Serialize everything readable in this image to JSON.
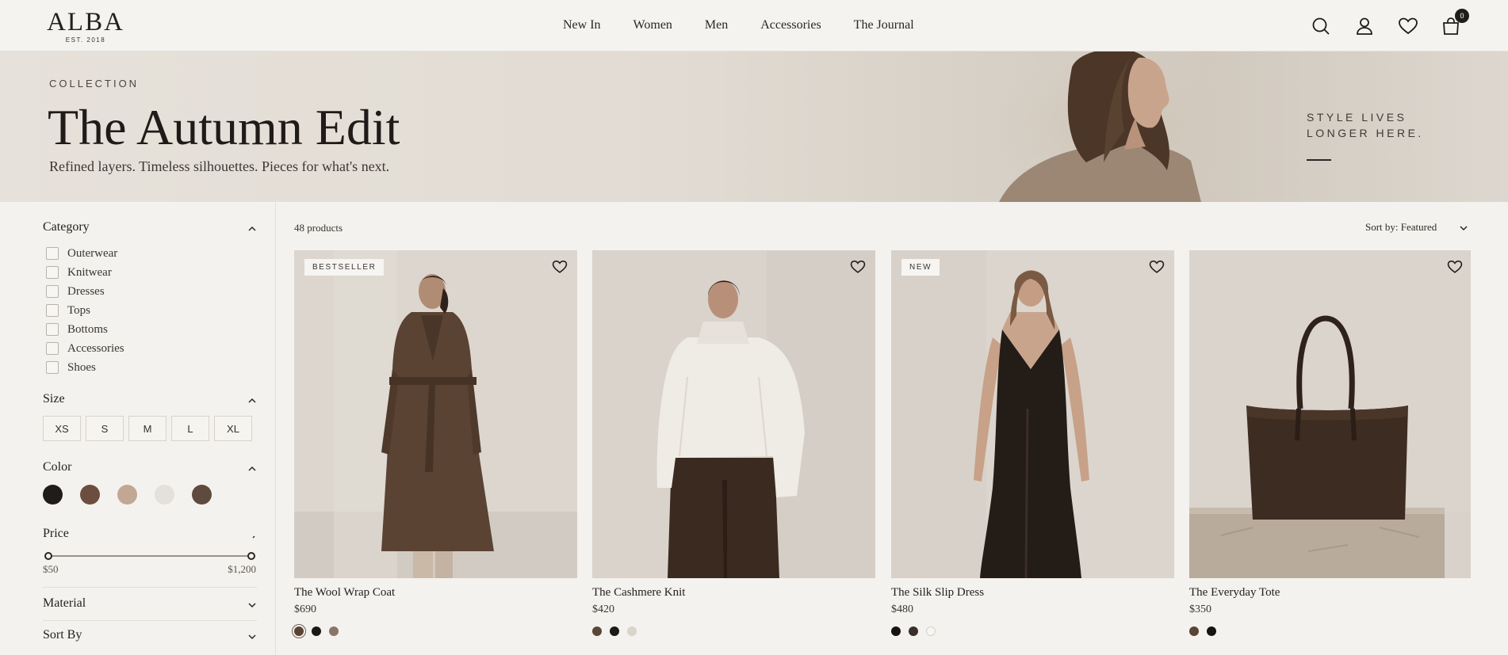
{
  "header": {
    "logo": {
      "name": "ALBA",
      "tagline": "EST. 2018"
    },
    "nav": [
      "New In",
      "Women",
      "Men",
      "Accessories",
      "The Journal"
    ],
    "icons": [
      "search-icon",
      "account-icon",
      "wishlist-icon",
      "bag-icon"
    ],
    "bag_count": "0"
  },
  "hero": {
    "eyebrow": "COLLECTION",
    "title": "The Autumn Edit",
    "subtitle": "Refined layers. Timeless silhouettes. Pieces for what's next.",
    "tagline_line1": "STYLE LIVES",
    "tagline_line2": "LONGER HERE."
  },
  "filters": {
    "category": {
      "label": "Category",
      "items": [
        "Outerwear",
        "Knitwear",
        "Dresses",
        "Tops",
        "Bottoms",
        "Accessories",
        "Shoes"
      ]
    },
    "size": {
      "label": "Size",
      "options": [
        "XS",
        "S",
        "M",
        "L",
        "XL"
      ]
    },
    "color": {
      "label": "Color",
      "swatches": [
        "#1f1c1a",
        "#6b4e3d",
        "#c2a792",
        "#e4e0db",
        "#5f4a3e"
      ]
    },
    "price": {
      "label": "Price",
      "min": "$50",
      "max": "$1,200"
    },
    "material": {
      "label": "Material"
    },
    "sort_by": {
      "label": "Sort By"
    }
  },
  "listing": {
    "count": "48 products",
    "sort": "Sort by:  Featured"
  },
  "products": [
    {
      "name": "The Wool Wrap Coat",
      "price": "$690",
      "badge": "BESTSELLER",
      "colors": [
        "#5a4333",
        "#1a1817",
        "#8a7566"
      ],
      "selected_color": 0
    },
    {
      "name": "The Cashmere Knit",
      "price": "$420",
      "badge": "",
      "colors": [
        "#5a4636",
        "#1c1a18",
        "#d9d5cd"
      ],
      "selected_color": -1
    },
    {
      "name": "The Silk Slip Dress",
      "price": "$480",
      "badge": "NEW",
      "colors": [
        "#161413",
        "#3a3029",
        "#f7f6f3"
      ],
      "selected_color": -1
    },
    {
      "name": "The Everyday Tote",
      "price": "$350",
      "badge": "",
      "colors": [
        "#5a4434",
        "#161413"
      ],
      "selected_color": -1
    }
  ],
  "colors": {
    "background": "#f4f2ee",
    "text": "#2a2724",
    "accent": "#1f1c19"
  }
}
